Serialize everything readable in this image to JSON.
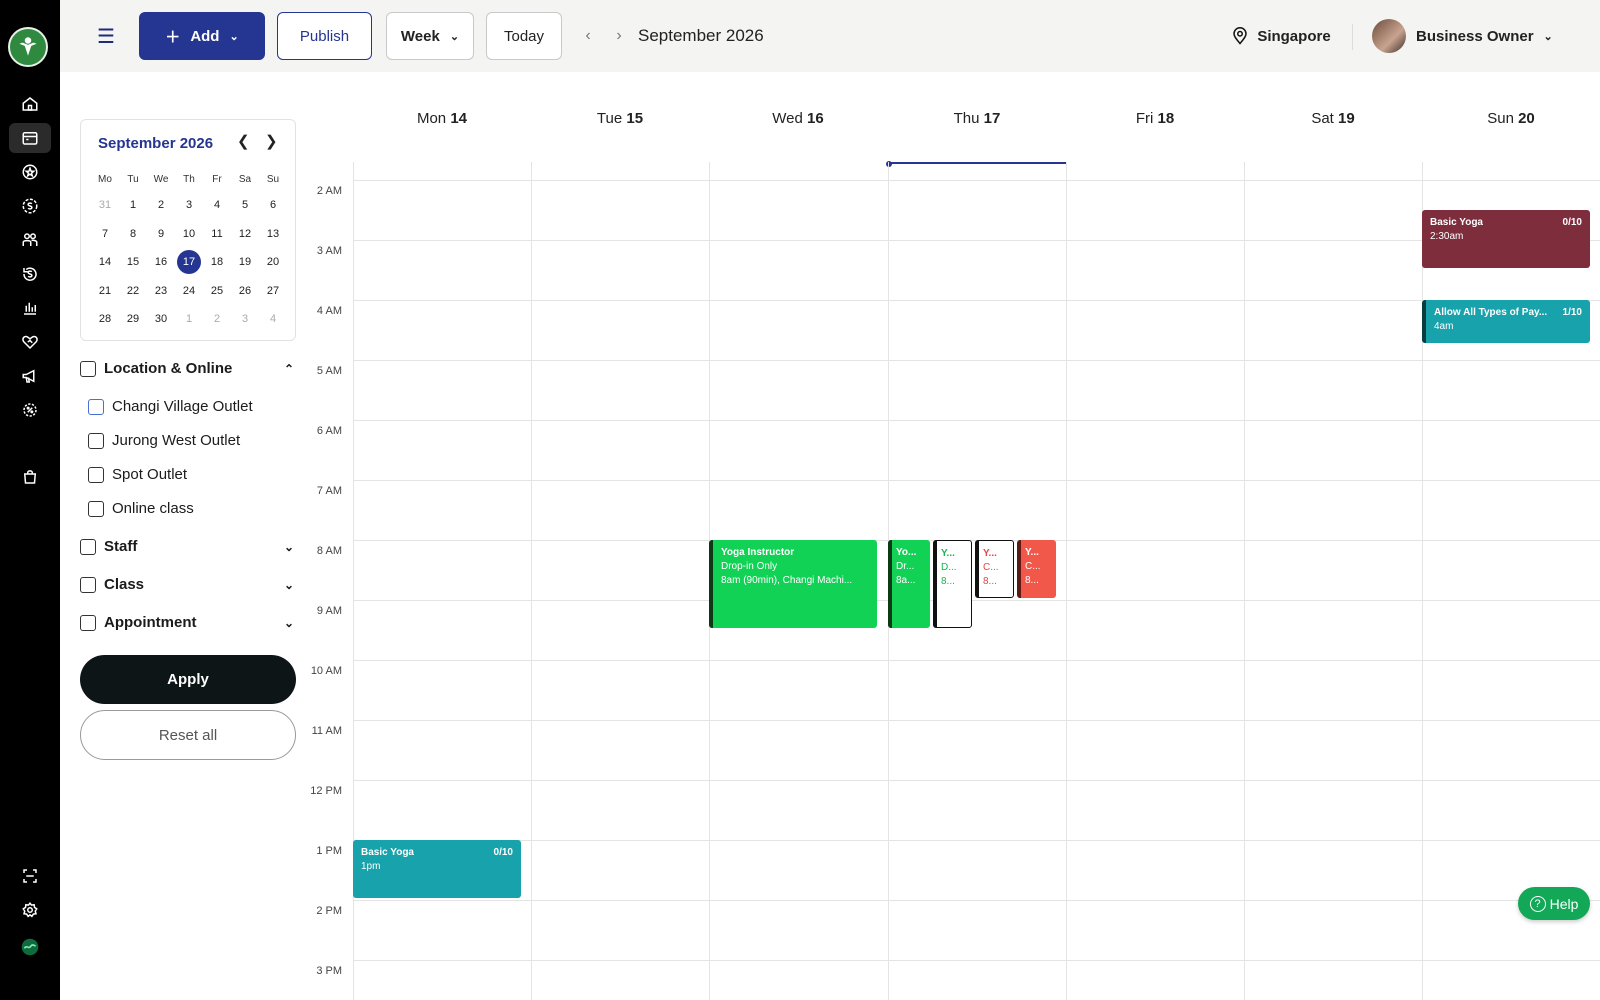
{
  "topbar": {
    "add_label": "Add",
    "publish_label": "Publish",
    "view_label": "Week",
    "today_label": "Today",
    "period_label": "September 2026",
    "location": "Singapore",
    "user_name": "Business Owner"
  },
  "mini_calendar": {
    "title": "September 2026",
    "weekdays": [
      "Mo",
      "Tu",
      "We",
      "Th",
      "Fr",
      "Sa",
      "Su"
    ],
    "days": [
      "31",
      "1",
      "2",
      "3",
      "4",
      "5",
      "6",
      "7",
      "8",
      "9",
      "10",
      "11",
      "12",
      "13",
      "14",
      "15",
      "16",
      "17",
      "18",
      "19",
      "20",
      "21",
      "22",
      "23",
      "24",
      "25",
      "26",
      "27",
      "28",
      "29",
      "30",
      "1",
      "2",
      "3",
      "4"
    ],
    "selected": "17"
  },
  "filters": {
    "location_header": "Location & Online",
    "locations": [
      "Changi Village Outlet",
      "Jurong West Outlet",
      "Spot Outlet",
      "Online class"
    ],
    "staff_header": "Staff",
    "class_header": "Class",
    "appointment_header": "Appointment",
    "apply_label": "Apply",
    "reset_label": "Reset all"
  },
  "week": {
    "days": [
      {
        "name": "Mon",
        "num": "14"
      },
      {
        "name": "Tue",
        "num": "15"
      },
      {
        "name": "Wed",
        "num": "16"
      },
      {
        "name": "Thu",
        "num": "17"
      },
      {
        "name": "Fri",
        "num": "18"
      },
      {
        "name": "Sat",
        "num": "19"
      },
      {
        "name": "Sun",
        "num": "20"
      }
    ],
    "hours": [
      "2 AM",
      "3 AM",
      "4 AM",
      "5 AM",
      "6 AM",
      "7 AM",
      "8 AM",
      "9 AM",
      "10 AM",
      "11 AM",
      "12 PM",
      "1 PM",
      "2 PM",
      "3 PM"
    ]
  },
  "events": {
    "sun_yoga": {
      "title": "Basic Yoga",
      "count": "0/10",
      "time": "2:30am"
    },
    "sun_pay": {
      "title": "Allow All Types of Pay...",
      "count": "1/10",
      "time": "4am"
    },
    "wed_yoga": {
      "title": "Yoga Instructor",
      "line1": "Drop-in Only",
      "line2": "8am (90min), Changi Machi..."
    },
    "thu_a": {
      "title": "Yo...",
      "line1": "Dr...",
      "line2": "8a..."
    },
    "thu_b": {
      "title": "Y...",
      "line1": "D...",
      "line2": "8..."
    },
    "thu_c": {
      "title": "Y...",
      "line1": "C...",
      "line2": "8..."
    },
    "thu_d": {
      "title": "Y...",
      "line1": "C...",
      "line2": "8..."
    },
    "mon_yoga": {
      "title": "Basic Yoga",
      "count": "0/10",
      "time": "1pm"
    }
  },
  "help_label": "Help"
}
